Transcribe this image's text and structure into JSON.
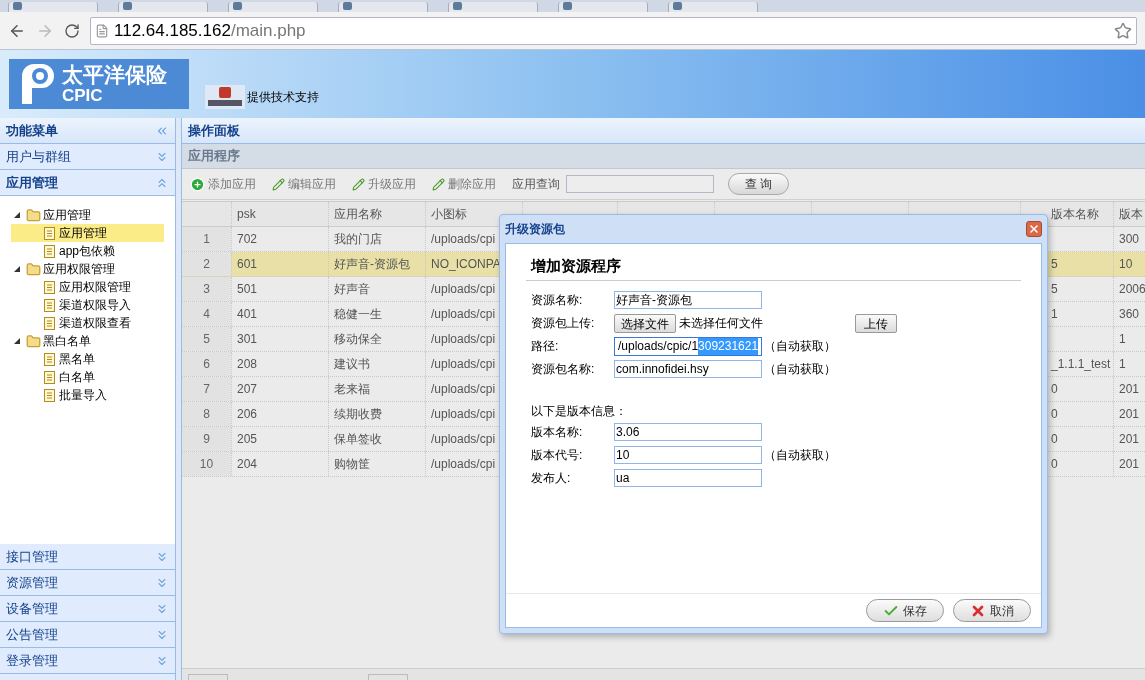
{
  "browser": {
    "url_host": "112.64.185.162",
    "url_path": "/main.php"
  },
  "header": {
    "logo_cn": "太平洋保险",
    "logo_en": "CPIC",
    "support_text": "提供技术支持"
  },
  "sidebar": {
    "title": "功能菜单",
    "sections": [
      {
        "label": "用户与群组",
        "expanded": false
      },
      {
        "label": "应用管理",
        "expanded": true,
        "tree": [
          {
            "label": "应用管理",
            "expanded": true,
            "children": [
              {
                "label": "应用管理",
                "selected": true
              },
              {
                "label": "app包依赖",
                "selected": false
              }
            ]
          },
          {
            "label": "应用权限管理",
            "expanded": true,
            "children": [
              {
                "label": "应用权限管理",
                "selected": false
              },
              {
                "label": "渠道权限导入",
                "selected": false
              },
              {
                "label": "渠道权限查看",
                "selected": false
              }
            ]
          },
          {
            "label": "黑白名单",
            "expanded": true,
            "children": [
              {
                "label": "黑名单",
                "selected": false
              },
              {
                "label": "白名单",
                "selected": false
              },
              {
                "label": "批量导入",
                "selected": false
              }
            ]
          }
        ]
      },
      {
        "label": "接口管理",
        "expanded": false
      },
      {
        "label": "资源管理",
        "expanded": false
      },
      {
        "label": "设备管理",
        "expanded": false
      },
      {
        "label": "公告管理",
        "expanded": false
      },
      {
        "label": "登录管理",
        "expanded": false
      }
    ]
  },
  "panel": {
    "title": "操作面板",
    "subtitle": "应用程序",
    "toolbar": [
      {
        "kind": "add",
        "label": "添加应用"
      },
      {
        "kind": "edit",
        "label": "编辑应用"
      },
      {
        "kind": "edit",
        "label": "升级应用"
      },
      {
        "kind": "edit",
        "label": "删除应用"
      }
    ],
    "search": {
      "label": "应用查询",
      "button": "查 询"
    }
  },
  "table": {
    "columns": [
      "psk",
      "应用名称",
      "小图标",
      "",
      "",
      "",
      "",
      "",
      "版本名称",
      "版本"
    ],
    "rows": [
      {
        "index": "1",
        "psk": "702",
        "name": "我的门店",
        "icon": "/uploads/cpi",
        "version_name": null,
        "version_code": "300",
        "selected": false
      },
      {
        "index": "2",
        "psk": "601",
        "name": "好声音-资源包",
        "icon": "NO_ICONPA",
        "version_name": "5",
        "version_code": "10",
        "selected": true
      },
      {
        "index": "3",
        "psk": "501",
        "name": "好声音",
        "icon": "/uploads/cpi",
        "version_name": "5",
        "version_code": "2006",
        "selected": false
      },
      {
        "index": "4",
        "psk": "401",
        "name": "稳健一生",
        "icon": "/uploads/cpi",
        "version_name": "1",
        "version_code": "360",
        "selected": false
      },
      {
        "index": "5",
        "psk": "301",
        "name": "移动保全",
        "icon": "/uploads/cpi",
        "version_name": null,
        "version_code": "1",
        "selected": false
      },
      {
        "index": "6",
        "psk": "208",
        "name": "建议书",
        "icon": "/uploads/cpi",
        "version_name": "_1.1.1_test",
        "version_code": "1",
        "selected": false
      },
      {
        "index": "7",
        "psk": "207",
        "name": "老来福",
        "icon": "/uploads/cpi",
        "version_name": "0",
        "version_code": "201",
        "selected": false
      },
      {
        "index": "8",
        "psk": "206",
        "name": "续期收费",
        "icon": "/uploads/cpi",
        "version_name": "0",
        "version_code": "201",
        "selected": false
      },
      {
        "index": "9",
        "psk": "205",
        "name": "保单签收",
        "icon": "/uploads/cpi",
        "version_name": "0",
        "version_code": "201",
        "selected": false
      },
      {
        "index": "10",
        "psk": "204",
        "name": "购物筐",
        "icon": "/uploads/cpi",
        "version_name": "0",
        "version_code": "201",
        "selected": false
      }
    ]
  },
  "dialog": {
    "title": "升级资源包",
    "heading": "增加资源程序",
    "fields": [
      {
        "kind": "input",
        "label": "资源名称:",
        "value": "好声音-资源包"
      },
      {
        "kind": "file",
        "label": "资源包上传:",
        "button": "选择文件",
        "status": "未选择任何文件",
        "action": "上传"
      },
      {
        "kind": "selection",
        "label": "路径:",
        "value": "/uploads/cpic/1",
        "selected_part": "309231621",
        "note": "（自动获取）"
      },
      {
        "kind": "input",
        "label": "资源包名称:",
        "value": "com.innofidei.hsy",
        "note": "（自动获取）"
      },
      {
        "kind": "spacer"
      },
      {
        "kind": "section",
        "label": "以下是版本信息："
      },
      {
        "kind": "input",
        "label": "版本名称:",
        "value": "3.06"
      },
      {
        "kind": "input",
        "label": "版本代号:",
        "value": "10",
        "note": "（自动获取）"
      },
      {
        "kind": "input",
        "label": "发布人:",
        "value": "ua"
      }
    ],
    "buttons": [
      {
        "kind": "save",
        "label": "保存"
      },
      {
        "kind": "cancel",
        "label": "取消"
      }
    ]
  }
}
